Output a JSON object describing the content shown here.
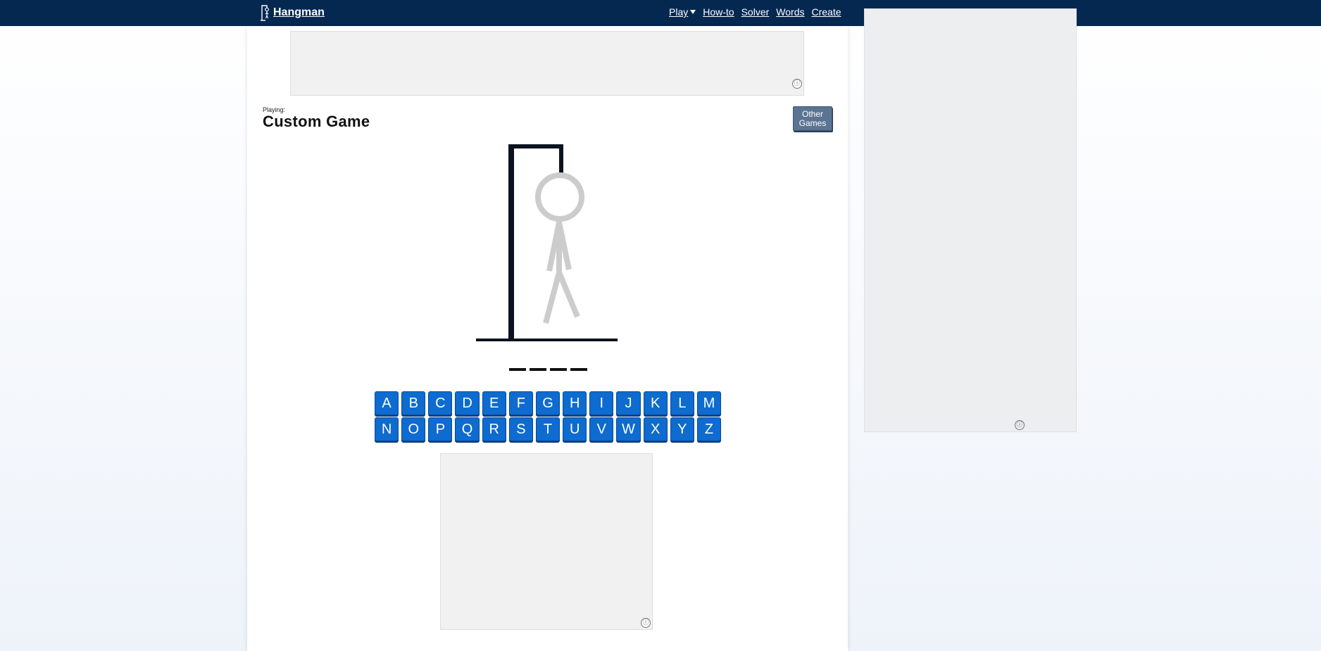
{
  "header": {
    "logo_text": "Hangman",
    "logo_icon": "hangman-figure-icon",
    "nav": {
      "play": "Play",
      "howto": "How-to",
      "solver": "Solver",
      "words": "Words",
      "create": "Create"
    }
  },
  "game": {
    "playing_label": "Playing:",
    "title": "Custom Game",
    "other_games_label": "Other\nGames",
    "word_blanks": [
      "_",
      "_",
      "_",
      "_"
    ]
  },
  "keyboard": {
    "row1": [
      "A",
      "B",
      "C",
      "D",
      "E",
      "F",
      "G",
      "H",
      "I",
      "J",
      "K",
      "L",
      "M"
    ],
    "row2": [
      "N",
      "O",
      "P",
      "Q",
      "R",
      "S",
      "T",
      "U",
      "V",
      "W",
      "X",
      "Y",
      "Z"
    ]
  },
  "ads": {
    "info_symbol": "ⓘ"
  },
  "colors": {
    "header_bg": "#052851",
    "key_bg": "#0e6bcf",
    "other_games_bg": "#5b7492",
    "gallows": "#0b1320",
    "figure": "#cccccc"
  }
}
